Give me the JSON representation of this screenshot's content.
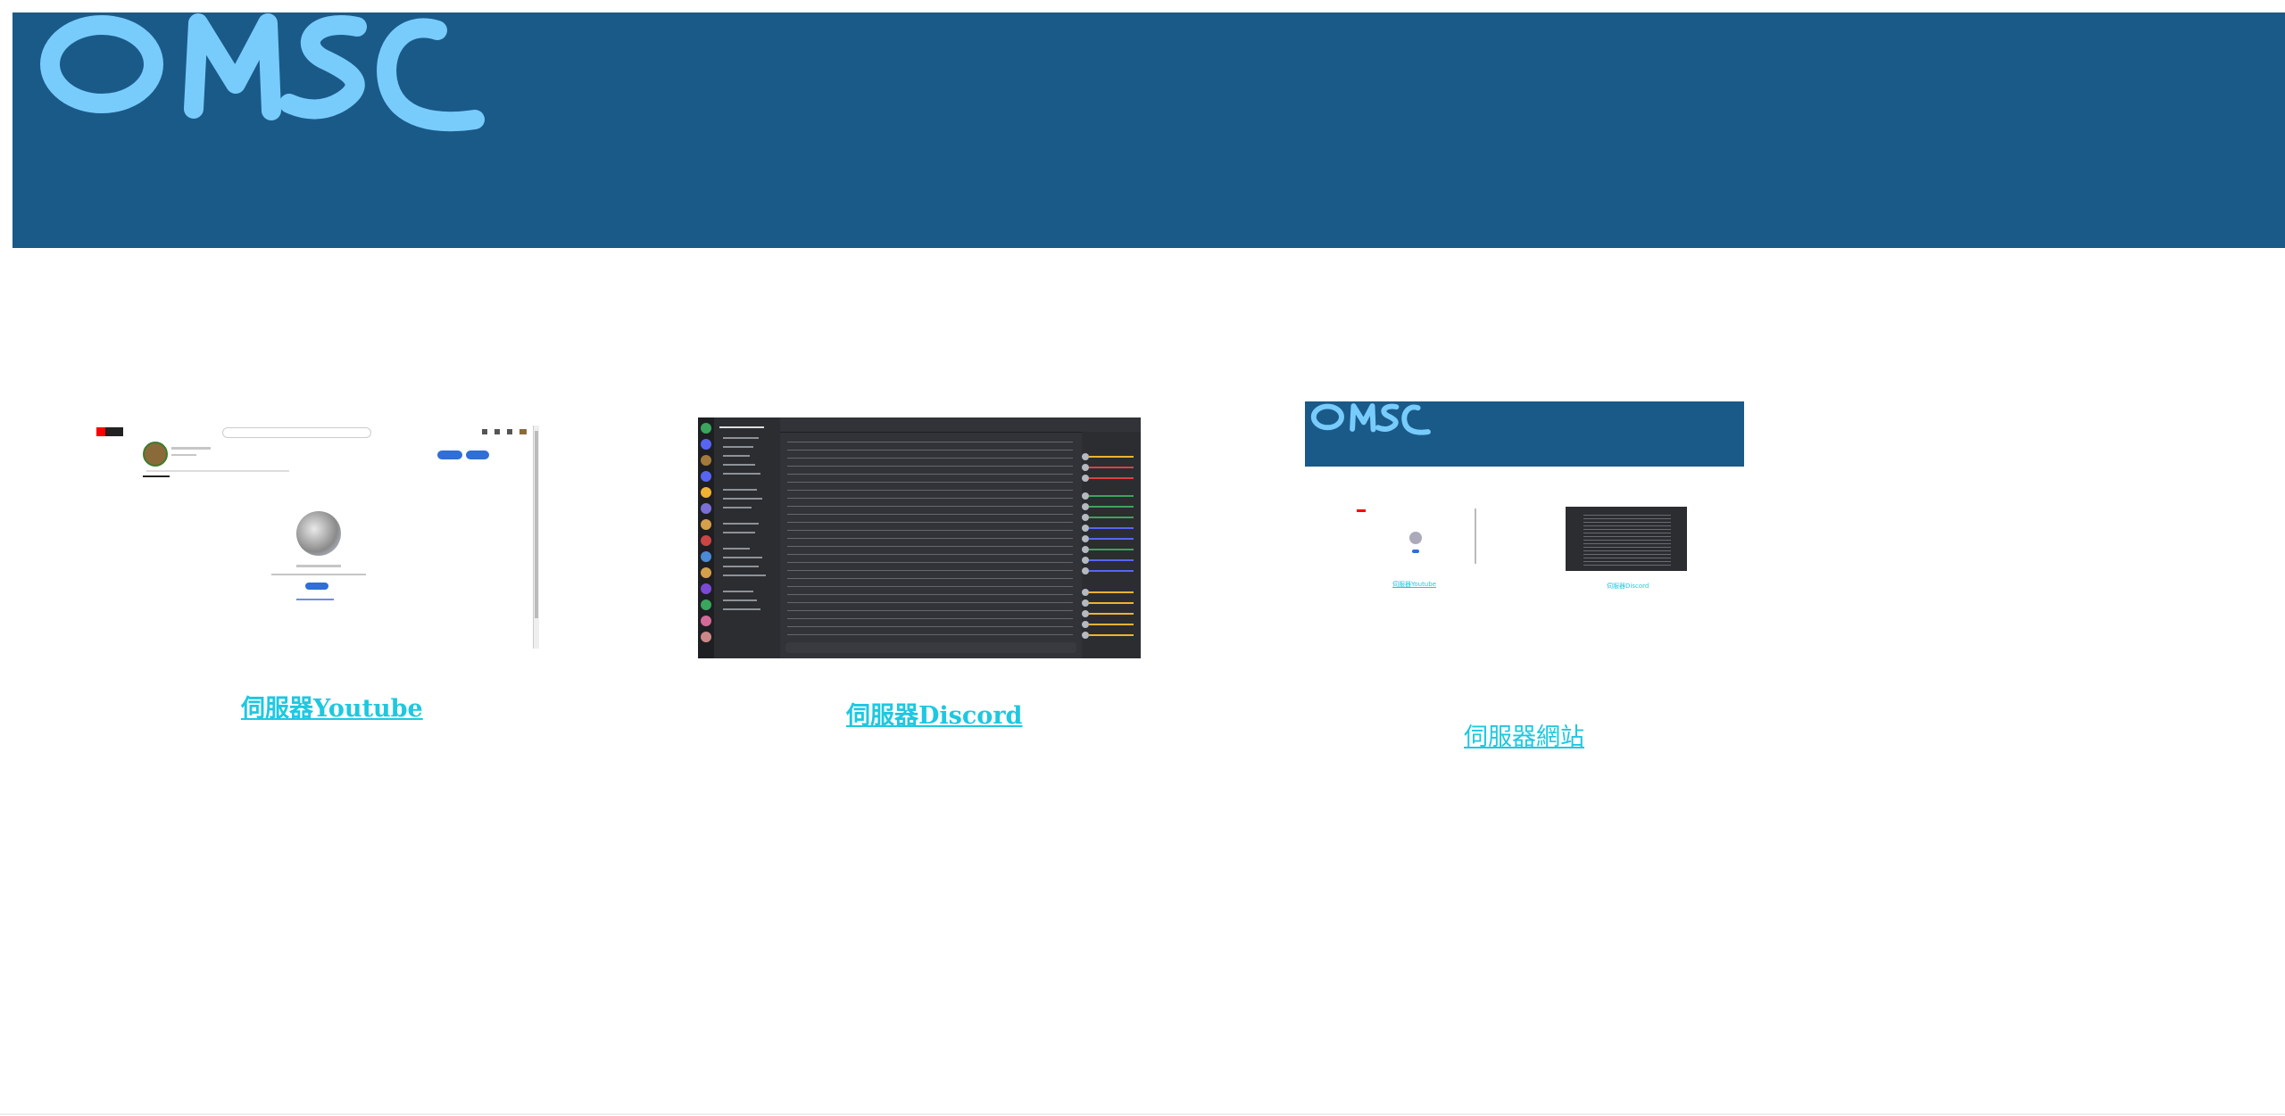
{
  "brand": {
    "logo_text": "OMSC",
    "banner_color": "#1a5a89",
    "logo_color": "#78ccfc"
  },
  "cards": [
    {
      "title": "伺服器Youtube",
      "icon": "youtube-channel-screenshot"
    },
    {
      "title": "伺服器Discord",
      "icon": "discord-server-screenshot"
    },
    {
      "title": "伺服器網站",
      "icon": "website-screenshot"
    }
  ],
  "website_preview": {
    "links": [
      "伺服器Youtube",
      "伺服器Discord"
    ]
  },
  "colors": {
    "link": "#1ec8e0",
    "background": "#ffffff"
  }
}
